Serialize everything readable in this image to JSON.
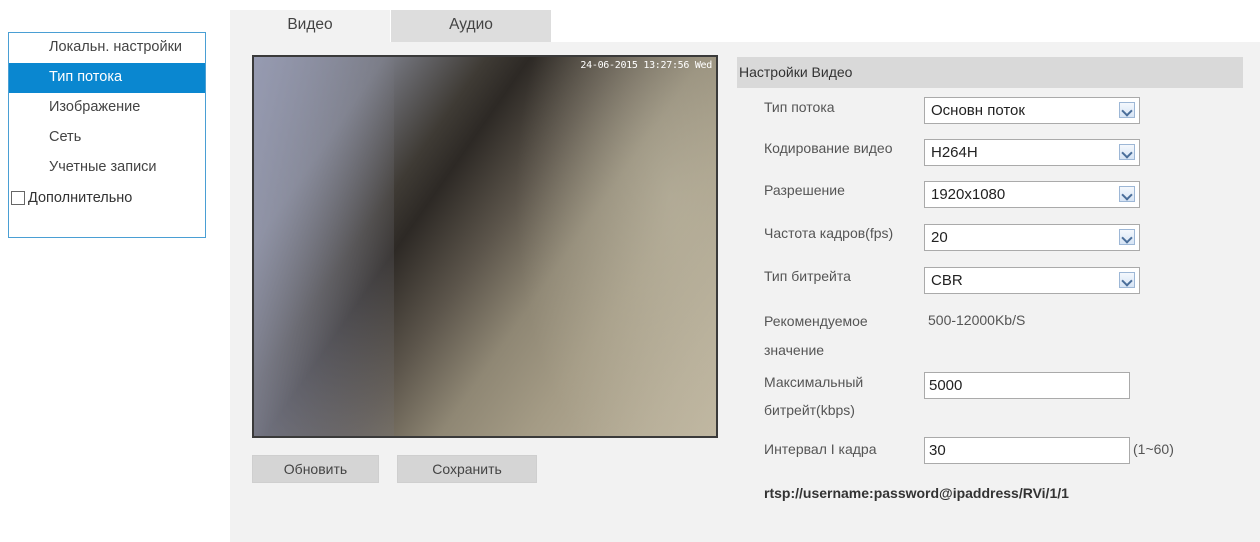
{
  "sidebar": {
    "items": [
      {
        "label": "Локальн. настройки"
      },
      {
        "label": "Тип потока"
      },
      {
        "label": "Изображение"
      },
      {
        "label": "Сеть"
      },
      {
        "label": "Учетные записи"
      },
      {
        "label": "Дополнительно"
      }
    ],
    "active_index": 1
  },
  "tabs": [
    {
      "label": "Видео"
    },
    {
      "label": "Аудио"
    }
  ],
  "video": {
    "osd_text": "24-06-2015 13:27:56 Wed"
  },
  "buttons": {
    "refresh": "Обновить",
    "save": "Сохранить"
  },
  "settings": {
    "header": "Настройки Видео",
    "stream_type": {
      "label": "Тип потока",
      "value": "Основн поток"
    },
    "video_encoding": {
      "label": "Кодирование видео",
      "value": "H264H"
    },
    "resolution": {
      "label": "Разрешение",
      "value": "1920x1080"
    },
    "frame_rate": {
      "label": "Частота кадров(fps)",
      "value": "20"
    },
    "bitrate_type": {
      "label": "Тип битрейта",
      "value": "CBR"
    },
    "recommended": {
      "label_line1": "Рекомендуемое",
      "label_line2": "значение",
      "value": "500-12000Kb/S"
    },
    "max_bitrate": {
      "label_line1": "Максимальный",
      "label_line2": "битрейт(kbps)",
      "value": "5000"
    },
    "iframe_interval": {
      "label": "Интервал I кадра",
      "value": "30",
      "range": "(1~60)"
    },
    "rtsp_url": "rtsp://username:password@ipaddress/RVi/1/1"
  },
  "colors": {
    "accent": "#0a87d0",
    "panel_bg": "#f2f2f2",
    "header_bg": "#d9d9d9"
  }
}
